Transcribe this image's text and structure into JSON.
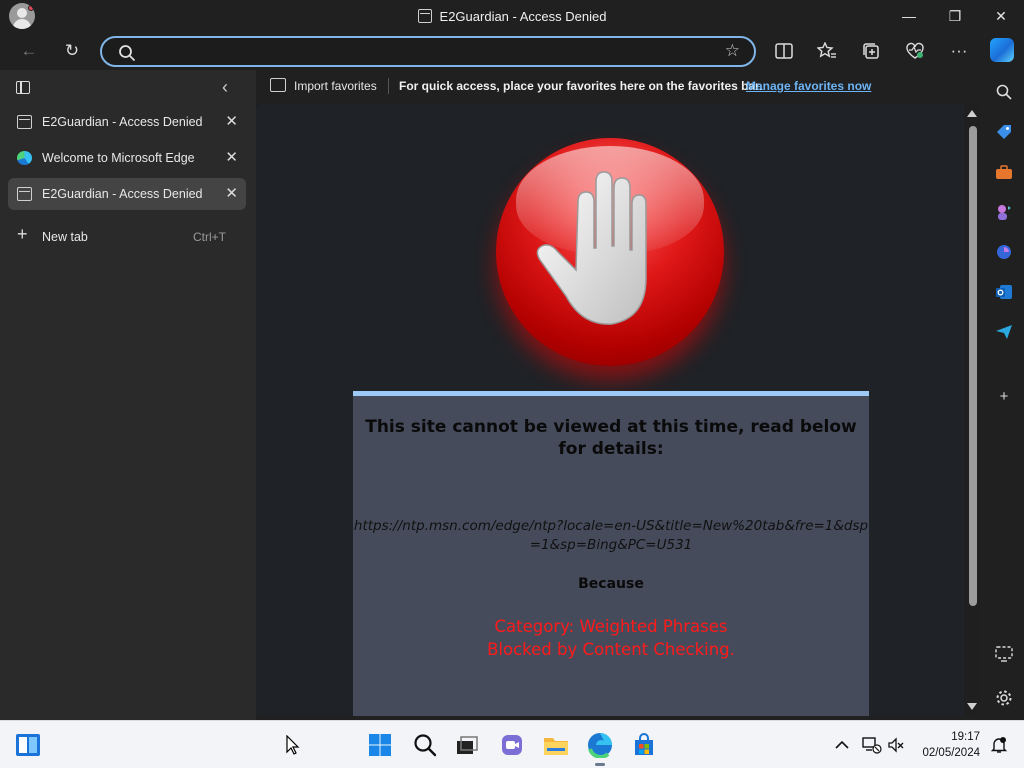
{
  "window": {
    "title": "E2Guardian - Access Denied",
    "minimize_glyph": "—",
    "restore_glyph": "❐",
    "close_glyph": "✕"
  },
  "toolbar": {
    "back_glyph": "←",
    "refresh_glyph": "↻",
    "favorite_glyph": "☆",
    "more_glyph": "···",
    "address_value": "",
    "address_placeholder": ""
  },
  "sidebar": {
    "collapse_glyph": "‹",
    "tabs": [
      {
        "label": "E2Guardian - Access Denied",
        "icon": "page-icon",
        "close": "✕"
      },
      {
        "label": "Welcome to Microsoft Edge",
        "icon": "edge-icon",
        "close": "✕"
      },
      {
        "label": "E2Guardian - Access Denied",
        "icon": "page-icon",
        "close": "✕"
      }
    ],
    "new_tab": {
      "label": "New tab",
      "shortcut": "Ctrl+T",
      "plus": "+"
    }
  },
  "favorites_bar": {
    "import_label": "Import favorites",
    "message": "For quick access, place your favorites here on the favorites bar.",
    "manage_link": "Manage favorites now"
  },
  "page": {
    "heading": "This site cannot be viewed at this time, read below for details:",
    "blocked_url": "https://ntp.msn.com/edge/ntp?locale=en-US&title=New%20tab&fre=1&dsp=1&sp=Bing&PC=U531",
    "because_label": "Because",
    "reason_line1": "Category: Weighted Phrases",
    "reason_line2": "Blocked by Content Checking."
  },
  "right_sidebar": {
    "add_glyph": "+"
  },
  "taskbar": {
    "time": "19:17",
    "date": "02/05/2024"
  },
  "colors": {
    "accent": "#7fb5e8",
    "link": "#6cb4f5",
    "reason_red": "#ff1a1a",
    "panel": "#454b5b",
    "panel_border": "#9cc9f5"
  }
}
